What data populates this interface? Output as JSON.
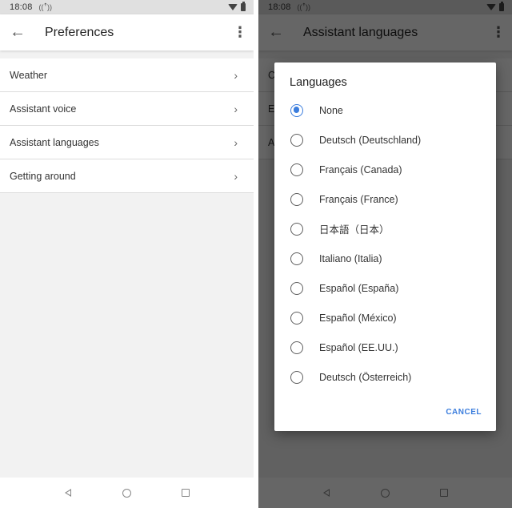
{
  "left_screen": {
    "status": {
      "time": "18:08",
      "radio_icon": "((ꜛ))"
    },
    "appbar": {
      "title": "Preferences",
      "back_icon": "←",
      "overflow_icon": "⋮"
    },
    "items": [
      {
        "label": "Weather",
        "chevron": "›"
      },
      {
        "label": "Assistant voice",
        "chevron": "›"
      },
      {
        "label": "Assistant languages",
        "chevron": "›"
      },
      {
        "label": "Getting around",
        "chevron": "›"
      }
    ]
  },
  "right_screen": {
    "status": {
      "time": "18:08",
      "radio_icon": "((ꜛ))"
    },
    "appbar": {
      "title": "Assistant languages",
      "back_icon": "←",
      "overflow_icon": "⋮"
    },
    "background_items": [
      {
        "label": "C",
        "chevron": ""
      },
      {
        "label": "E",
        "chevron": "›"
      },
      {
        "label": "A",
        "chevron": "–"
      }
    ],
    "dialog": {
      "title": "Languages",
      "selected_index": 0,
      "options": [
        "None",
        "Deutsch (Deutschland)",
        "Français (Canada)",
        "Français (France)",
        "日本語（日本）",
        "Italiano (Italia)",
        "Español (España)",
        "Español (México)",
        "Español (EE.UU.)",
        "Deutsch (Österreich)"
      ],
      "cancel_label": "CANCEL"
    }
  },
  "colors": {
    "accent": "#3b7ddd",
    "scrim": "rgba(0,0,0,0.6)"
  }
}
